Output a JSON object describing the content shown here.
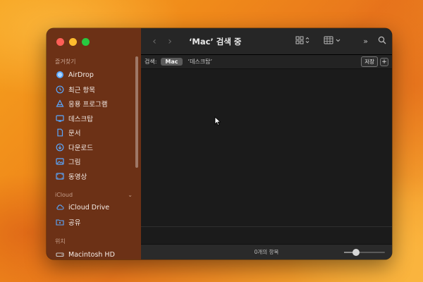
{
  "window": {
    "title": "‘Mac’ 검색 중"
  },
  "sidebar": {
    "favorites_header": "즐겨찾기",
    "favorites": [
      {
        "label": "AirDrop",
        "icon": "airdrop-icon"
      },
      {
        "label": "최근 항목",
        "icon": "clock-icon"
      },
      {
        "label": "응용 프로그램",
        "icon": "applications-icon"
      },
      {
        "label": "데스크탑",
        "icon": "desktop-icon"
      },
      {
        "label": "문서",
        "icon": "document-icon"
      },
      {
        "label": "다운로드",
        "icon": "download-icon"
      },
      {
        "label": "그림",
        "icon": "pictures-icon"
      },
      {
        "label": "동영상",
        "icon": "movies-icon"
      }
    ],
    "icloud_header": "iCloud",
    "icloud": [
      {
        "label": "iCloud Drive",
        "icon": "cloud-icon"
      },
      {
        "label": "공유",
        "icon": "shared-folder-icon"
      }
    ],
    "locations_header": "위치",
    "locations": [
      {
        "label": "Macintosh HD",
        "icon": "disk-icon"
      }
    ]
  },
  "scope": {
    "label": "검색:",
    "selected": "Mac",
    "other": "‘데스크탑’",
    "save": "저장",
    "add": "+"
  },
  "status": {
    "count": "0개의 항목",
    "icon_size_fraction": 0.25
  },
  "colors": {
    "sidebar_accent": "#5aa8ff",
    "close": "#ff5f57",
    "minimize": "#febc2e",
    "zoom": "#28c840"
  }
}
